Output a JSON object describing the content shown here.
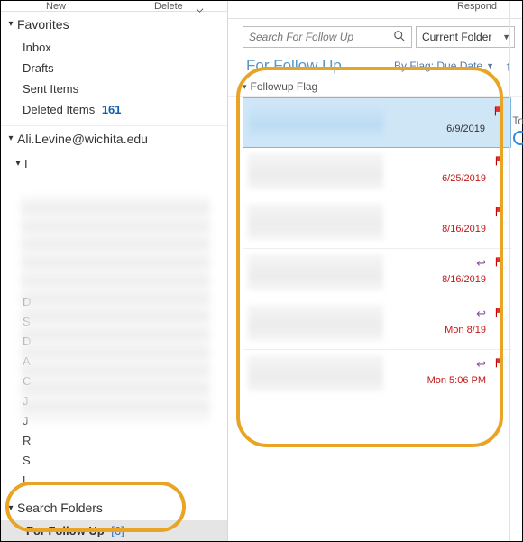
{
  "ribbon": {
    "new": "New",
    "delete": "Delete",
    "respond": "Respond"
  },
  "favorites": {
    "header": "Favorites",
    "items": [
      {
        "name": "Inbox",
        "count": ""
      },
      {
        "name": "Drafts",
        "count": ""
      },
      {
        "name": "Sent Items",
        "count": ""
      },
      {
        "name": "Deleted Items",
        "count": "161"
      }
    ]
  },
  "account": {
    "header": "Ali.Levine@wichita.edu"
  },
  "mini_folders": [
    "D",
    "S",
    "D",
    "A",
    "C",
    "J",
    "J",
    "R",
    "S",
    "L"
  ],
  "search_folders": {
    "header": "Search Folders",
    "item": {
      "name": "For Follow Up",
      "count": "[6]"
    }
  },
  "search": {
    "placeholder": "Search For Follow Up",
    "scope": "Current Folder"
  },
  "list": {
    "title": "For Follow Up",
    "sort": "By Flag: Due Date",
    "group": "Followup Flag"
  },
  "messages": [
    {
      "date": "6/9/2019",
      "reply": false,
      "selected": true
    },
    {
      "date": "6/25/2019",
      "reply": false,
      "selected": false
    },
    {
      "date": "8/16/2019",
      "reply": false,
      "selected": false
    },
    {
      "date": "8/16/2019",
      "reply": true,
      "selected": false
    },
    {
      "date": "Mon 8/19",
      "reply": true,
      "selected": false
    },
    {
      "date": "Mon 5:06 PM",
      "reply": true,
      "selected": false
    }
  ],
  "reading_pane": {
    "to": "To"
  }
}
